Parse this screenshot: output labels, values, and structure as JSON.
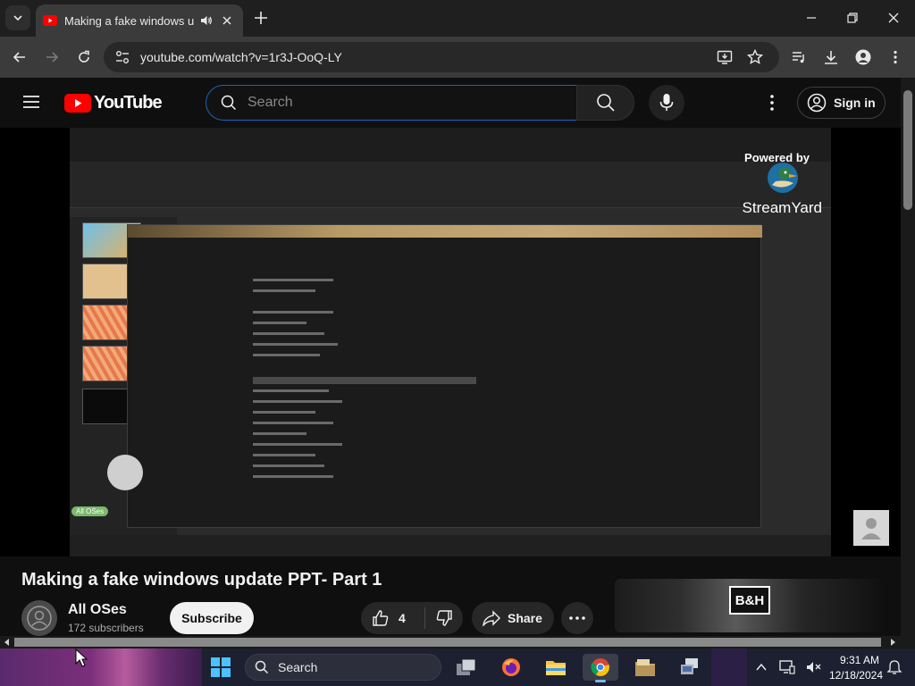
{
  "browser": {
    "tab_title": "Making a fake windows upd",
    "url": "youtube.com/watch?v=1r3J-OoQ-LY"
  },
  "youtube": {
    "logo_text": "YouTube",
    "search_placeholder": "Search",
    "signin_label": "Sign in"
  },
  "video": {
    "title": "Making a fake windows update PPT- Part 1",
    "channel_name": "All OSes",
    "subscribers": "172 subscribers",
    "subscribe_label": "Subscribe",
    "like_count": "4",
    "share_label": "Share",
    "frame_overlay": {
      "powered_by": "Powered by",
      "streamyard": "StreamYard",
      "name_tag": "All OSes"
    }
  },
  "ad": {
    "brand": "B&H"
  },
  "taskbar": {
    "search_label": "Search",
    "time": "9:31 AM",
    "date": "12/18/2024"
  },
  "colors": {
    "youtube_red": "#ff0000",
    "search_focus_border": "#1c62b9",
    "page_background": "#0f0f0f",
    "chrome_toolbar": "#3b3b3b"
  }
}
